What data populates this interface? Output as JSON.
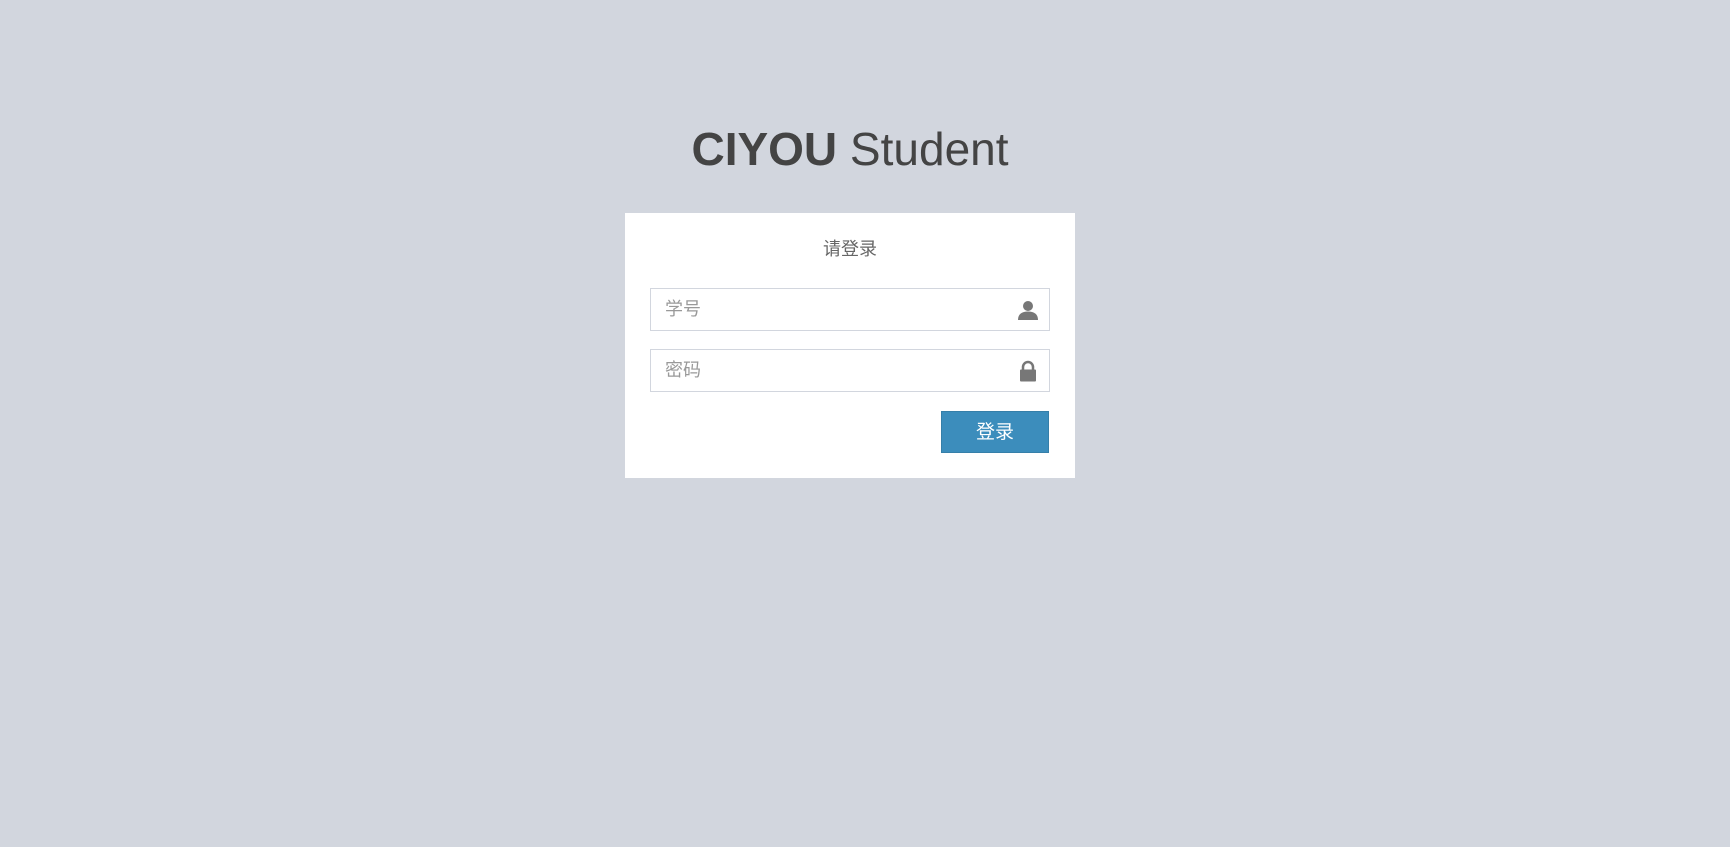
{
  "logo": {
    "bold": "CIYOU",
    "normal": " Student"
  },
  "login_box": {
    "message": "请登录",
    "username": {
      "placeholder": "学号",
      "value": "",
      "icon": "user-icon"
    },
    "password": {
      "placeholder": "密码",
      "value": "",
      "icon": "lock-icon"
    },
    "submit_label": "登录"
  },
  "colors": {
    "background": "#d2d6de",
    "primary": "#3c8dbc",
    "text": "#444444",
    "icon": "#777777"
  }
}
